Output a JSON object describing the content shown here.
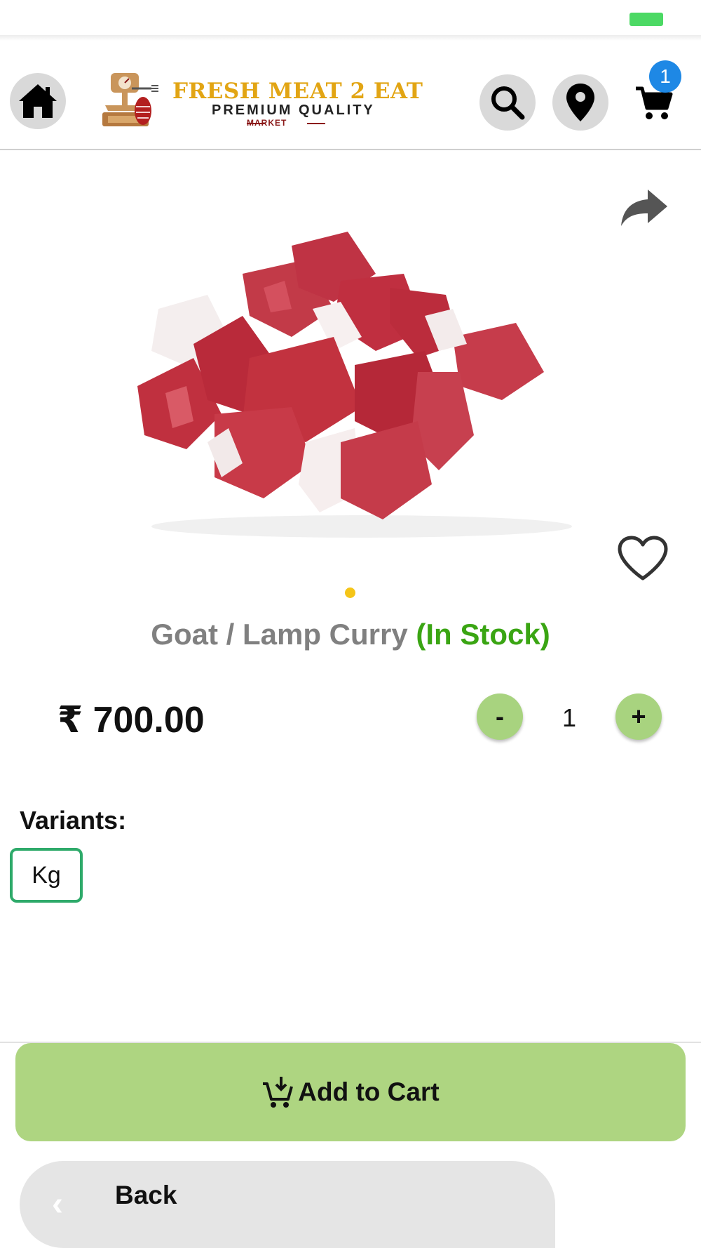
{
  "header": {
    "logo": {
      "title": "FRESH MEAT 2 EAT",
      "subtitle": "PREMIUM QUALITY",
      "tag": "MARKET"
    },
    "cart_count": "1",
    "icons": [
      "home-icon",
      "search-icon",
      "location-pin-icon",
      "cart-icon"
    ]
  },
  "product": {
    "name": "Goat / Lamp Curry",
    "stock_status": "(In Stock)",
    "price": "₹ 700.00",
    "quantity": "1",
    "minus_label": "-",
    "plus_label": "+",
    "image_dots": 1
  },
  "variants": {
    "label": "Variants:",
    "options": [
      "Kg"
    ],
    "selected": "Kg"
  },
  "actions": {
    "add_to_cart": "Add to Cart",
    "back": "Back",
    "back_chevron": "‹"
  },
  "colors": {
    "accent_green": "#aed581",
    "in_stock_green": "#3aa513",
    "variant_border": "#2eaa6a",
    "badge_blue": "#1e88e5",
    "dot_yellow": "#f5c518",
    "logo_gold": "#e2a514"
  }
}
